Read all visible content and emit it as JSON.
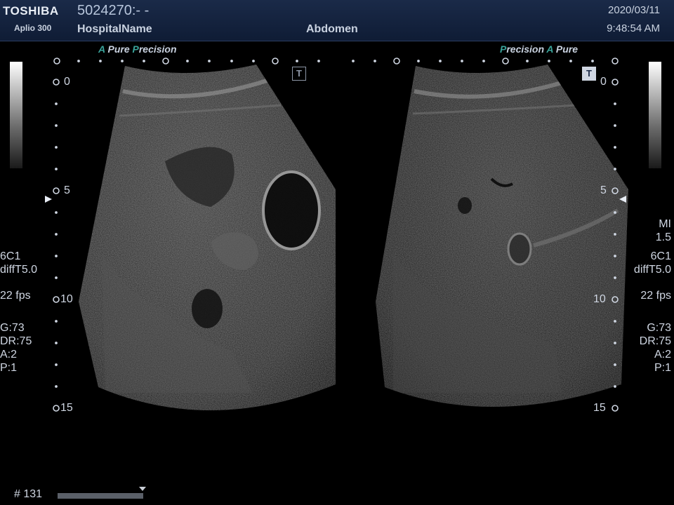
{
  "header": {
    "brand": "TOSHIBA",
    "model": "Aplio 300",
    "patient_id": "5024270:- -",
    "hospital": "HospitalName",
    "preset": "Abdomen",
    "date": "2020/03/11",
    "time": "9:48:54 AM"
  },
  "left_image": {
    "badge": {
      "accent": "A",
      "pure": "Pure",
      "p": "P",
      "precision": "recision"
    },
    "tmark": "T",
    "depth_labels": [
      "0",
      "5",
      "10",
      "15"
    ]
  },
  "right_image": {
    "badge": {
      "p": "P",
      "precision": "recision",
      "accent": "A",
      "pure": "Pure"
    },
    "tmark": "T",
    "depth_labels": [
      "0",
      "5",
      "10",
      "15"
    ]
  },
  "left_params": {
    "probe": "6C1",
    "mode": "diffT5.0",
    "fps": "22 fps",
    "gain": "G:73",
    "dr": "DR:75",
    "a": "A:2",
    "p": "P:1"
  },
  "right_params": {
    "mi_label": "MI",
    "mi_value": "1.5",
    "probe": "6C1",
    "mode": "diffT5.0",
    "fps": "22 fps",
    "gain": "G:73",
    "dr": "DR:75",
    "a": "A:2",
    "p": "P:1"
  },
  "cine": {
    "frame": "# 131"
  },
  "colors": {
    "accent": "#3aa39a",
    "header_bg": "#1a2a48",
    "text": "#cfd6e2"
  },
  "icons": {
    "transducer_mark": "t-mark-icon",
    "focus": "focus-triangle-icon"
  }
}
